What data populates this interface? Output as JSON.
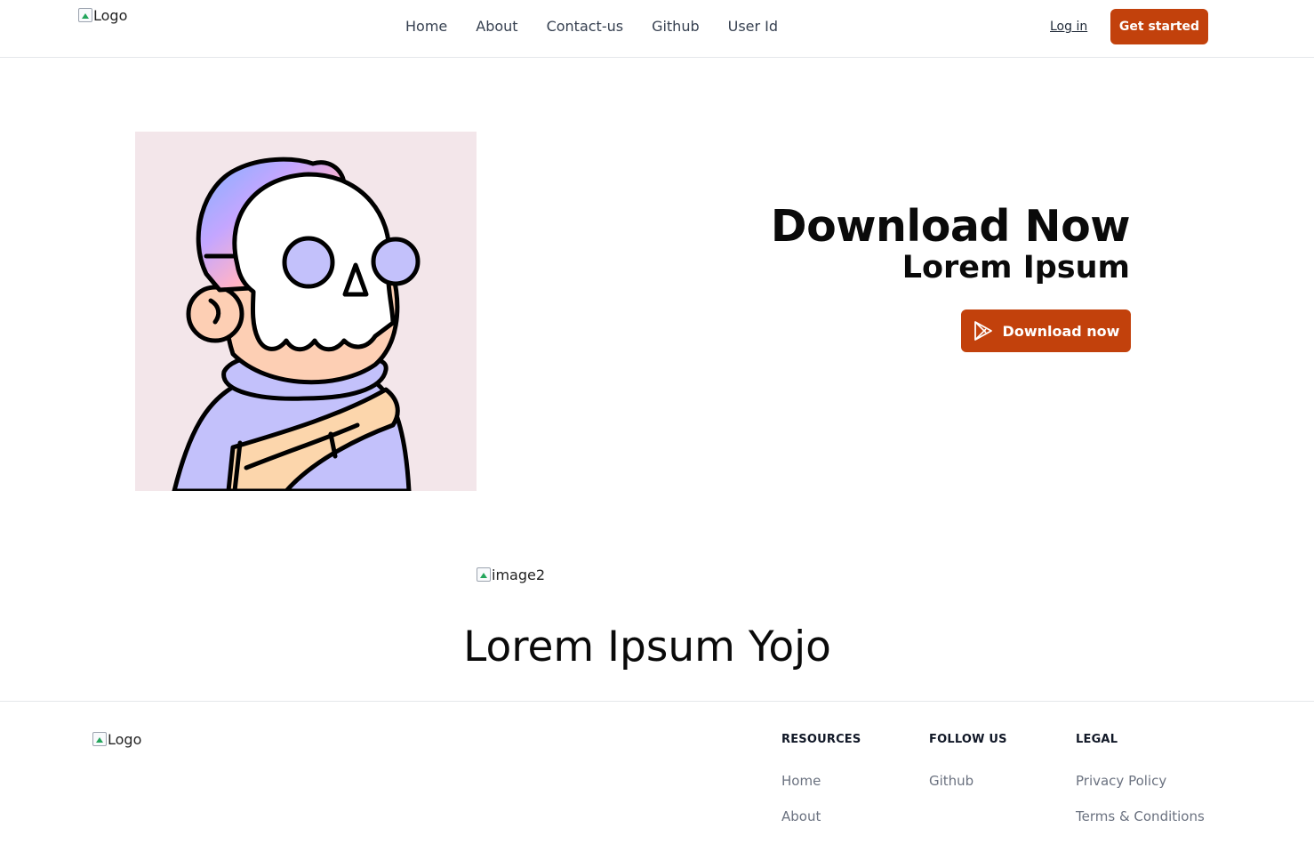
{
  "header": {
    "logo_alt": "Logo",
    "nav": [
      {
        "label": "Home"
      },
      {
        "label": "About"
      },
      {
        "label": "Contact-us"
      },
      {
        "label": "Github"
      },
      {
        "label": "User Id"
      }
    ],
    "login_label": "Log in",
    "cta_label": "Get started"
  },
  "hero": {
    "title": "Download Now",
    "subtitle": "Lorem Ipsum",
    "download_label": "Download now",
    "download_icon": "play-store-icon",
    "illustration": "skull-mask-character-illustration"
  },
  "middle": {
    "image_alt": "image2",
    "title": "Lorem Ipsum Yojo"
  },
  "footer": {
    "logo_alt": "Logo",
    "columns": [
      {
        "heading": "RESOURCES",
        "links": [
          "Home",
          "About"
        ]
      },
      {
        "heading": "FOLLOW US",
        "links": [
          "Github"
        ]
      },
      {
        "heading": "LEGAL",
        "links": [
          "Privacy Policy",
          "Terms & Conditions"
        ]
      }
    ]
  },
  "colors": {
    "accent": "#c2410c",
    "illustration_bg": "#f3e6ea"
  }
}
